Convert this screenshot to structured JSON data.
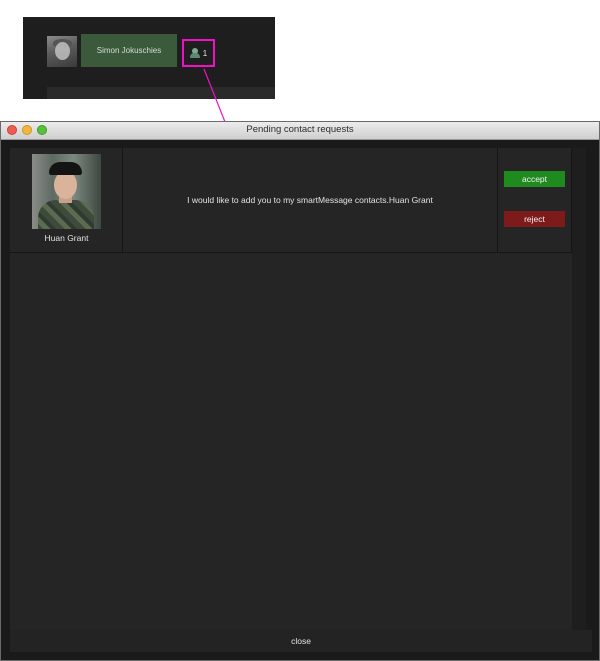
{
  "top_snippet": {
    "user_name": "Simon Jokuschies",
    "pending_count": "1"
  },
  "window": {
    "title": "Pending contact requests"
  },
  "requests": [
    {
      "name": "Huan Grant",
      "message": "I would like to add you to my smartMessage contacts.Huan Grant",
      "accept_label": "accept",
      "reject_label": "reject"
    }
  ],
  "footer": {
    "close_label": "close"
  },
  "colors": {
    "highlight": "#f011c6",
    "accept": "#1f8a1e",
    "reject": "#7d1b1b",
    "user_chip": "#3b5a3b"
  },
  "icons": [
    "user-avatar",
    "person-icon",
    "arrow-annotation",
    "close-window-icon",
    "minimize-window-icon",
    "maximize-window-icon"
  ]
}
